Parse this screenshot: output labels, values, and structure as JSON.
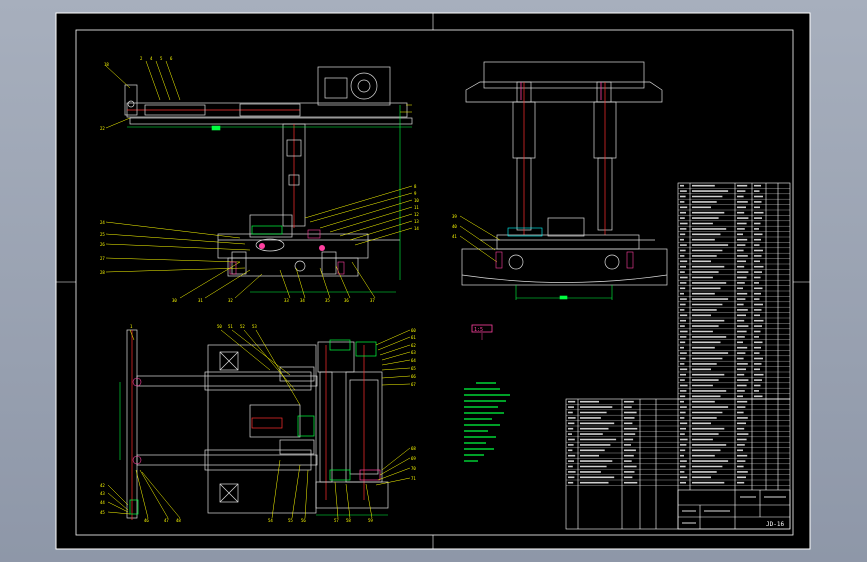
{
  "drawing": {
    "title_block_code": "JD-16",
    "colors": {
      "background": "#000000",
      "frame": "#ffffff",
      "leader": "#ffff00",
      "dimension": "#00ff00",
      "centerline": "#ff3030",
      "part": "#e0e0e0",
      "notes": "#00ff40",
      "magenta_mark": "#ff40a0",
      "viewport": "#9ba4b4"
    }
  }
}
